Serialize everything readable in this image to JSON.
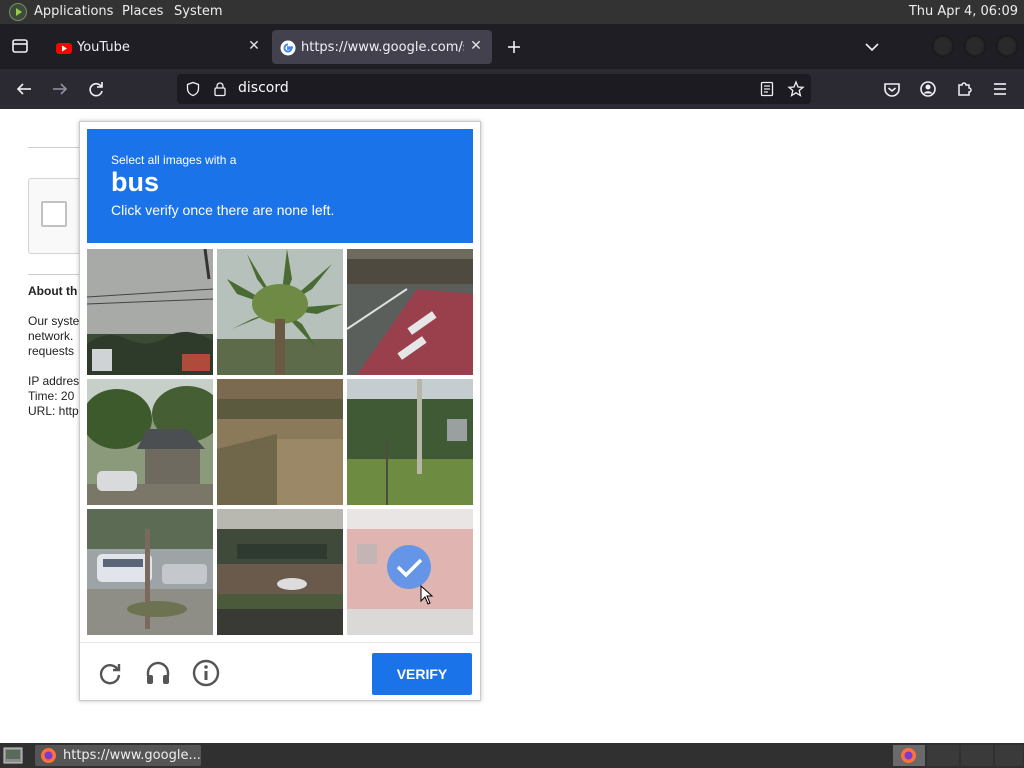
{
  "desktop": {
    "menus": [
      "Applications",
      "Places",
      "System"
    ],
    "clock": "Thu Apr  4, 06:09"
  },
  "tabs": [
    {
      "label": "YouTube",
      "active": false
    },
    {
      "label": "https://www.google.com/se",
      "active": true
    }
  ],
  "navbar": {
    "url": "discord"
  },
  "page": {
    "about_heading": "About th",
    "about_lines": [
      "Our syste",
      "network.",
      "requests"
    ],
    "meta_lines": [
      "IP addres",
      "Time: 20",
      "URL: http"
    ]
  },
  "captcha": {
    "instruction_line1": "Select all images with a",
    "target_object": "bus",
    "instruction_line3": "Click verify once there are none left.",
    "verify_label": "VERIFY",
    "tiles": [
      {
        "id": 1,
        "content": "power-lines-sky",
        "selected": false
      },
      {
        "id": 2,
        "content": "palm-tree",
        "selected": false
      },
      {
        "id": 3,
        "content": "bus-lane-road",
        "selected": false
      },
      {
        "id": 4,
        "content": "house-with-car",
        "selected": false
      },
      {
        "id": 5,
        "content": "dirt-field",
        "selected": false
      },
      {
        "id": 6,
        "content": "grass-field-pole",
        "selected": false
      },
      {
        "id": 7,
        "content": "street-with-van",
        "selected": false
      },
      {
        "id": 8,
        "content": "plaza-building",
        "selected": false
      },
      {
        "id": 9,
        "content": "red-bus",
        "selected": true
      }
    ]
  },
  "taskbar": {
    "task_label": "https://www.google..."
  },
  "colors": {
    "accent": "#1a73e8",
    "browser_chrome": "#2b2a33",
    "tab_strip": "#1f1e25"
  }
}
